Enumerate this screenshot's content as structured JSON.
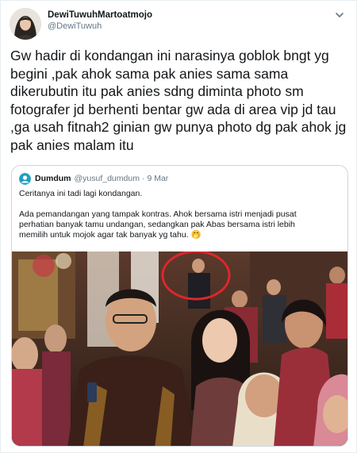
{
  "tweet": {
    "author": {
      "display_name": "DewiTuwuhMartoatmojo",
      "handle": "@DewiTuwuh"
    },
    "text": "Gw hadir di kondangan ini narasinya goblok bngt yg\nbegini ,pak ahok sama pak anies sama sama\ndikerubutin itu pak anies sdng diminta photo sm\nfotografer jd berhenti bentar gw ada di area vip jd tau\n,ga usah fitnah2 ginian gw punya photo dg pak ahok jg\npak anies malam itu",
    "menu_icon": "chevron-down-icon"
  },
  "quoted_tweet": {
    "author": {
      "display_name": "Dumdum",
      "handle": "@yusuf_dumdum",
      "separator": "·",
      "date": "9 Mar"
    },
    "text": "Ceritanya ini tadi lagi kondangan.\n\nAda pemandangan yang tampak kontras. Ahok bersama istri menjadi pusat\nperhatian banyak tamu undangan, sedangkan pak Abas bersama istri lebih\nmemilih untuk mojok agar tak banyak yg tahu. 🤭",
    "photo_icon": "event-photo",
    "highlight_color": "#e0262a"
  },
  "colors": {
    "text": "#14171a",
    "secondary": "#657786",
    "border": "#e6ecf0",
    "quote_border": "#ccd6dd"
  }
}
